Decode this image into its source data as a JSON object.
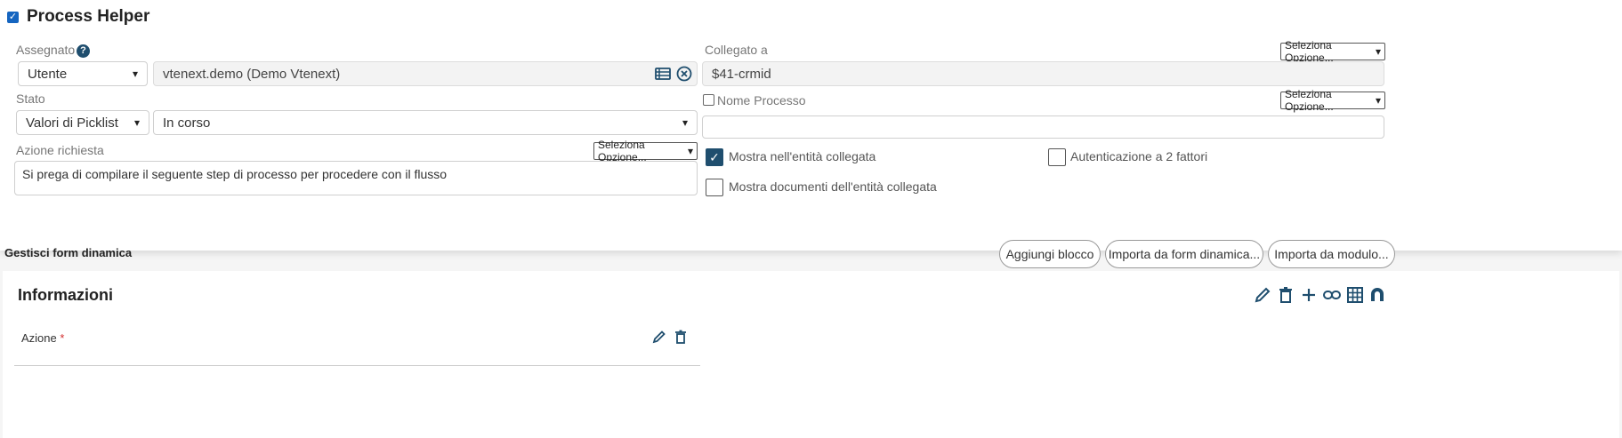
{
  "header": {
    "title": "Process Helper",
    "enabled": true
  },
  "assigned": {
    "label": "Assegnato a",
    "type_value": "Utente",
    "user_value": "vtenext.demo (Demo Vtenext)"
  },
  "linked": {
    "label": "Collegato a",
    "option_label": "Seleziona Opzione...",
    "value": "$41-crmid"
  },
  "status": {
    "label": "Stato",
    "source_value": "Valori di Picklist",
    "value": "In corso"
  },
  "process_name": {
    "label": "Nome Processo",
    "checked": false,
    "option_label": "Seleziona Opzione...",
    "value": ""
  },
  "action_required": {
    "label": "Azione richiesta",
    "option_label": "Seleziona Opzione...",
    "value": "Si prega di compilare il seguente step di processo per procedere con il flusso"
  },
  "options": {
    "show_in_linked": {
      "label": "Mostra nell'entità collegata",
      "checked": true
    },
    "two_factor": {
      "label": "Autenticazione a 2 fattori",
      "checked": false
    },
    "show_docs": {
      "label": "Mostra documenti dell'entità collegata",
      "checked": false
    }
  },
  "dynamic_form": {
    "title": "Gestisci form dinamica",
    "buttons": {
      "add_block": "Aggiungi blocco",
      "import_form": "Importa da form dinamica...",
      "import_module": "Importa da modulo..."
    }
  },
  "block": {
    "title": "Informazioni",
    "fields": [
      {
        "label": "Azione",
        "required_mark": "*"
      }
    ]
  },
  "colors": {
    "accent": "#1f4e6e",
    "primary_check": "#1565c0",
    "required": "#d32f2f"
  }
}
